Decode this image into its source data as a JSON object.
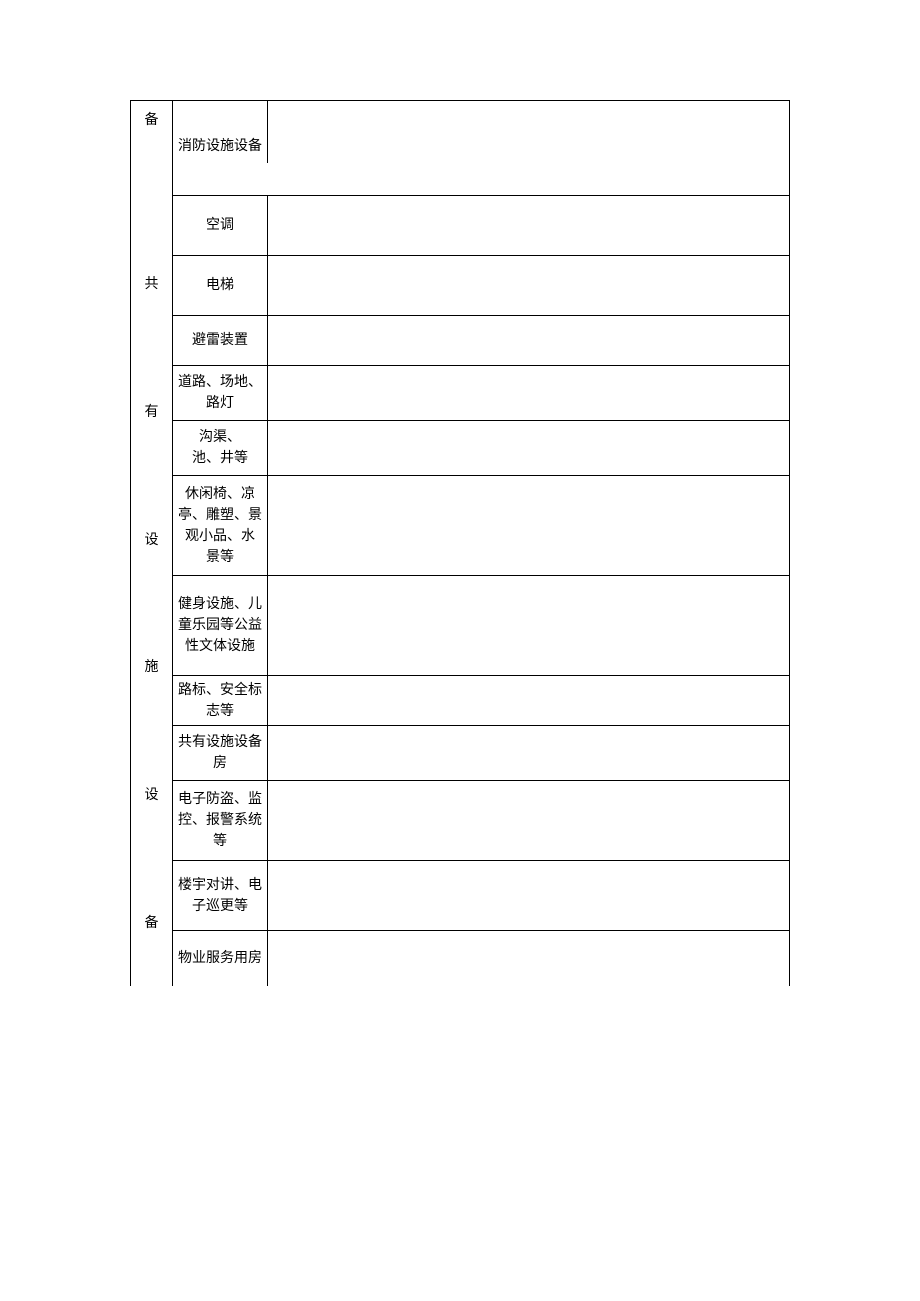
{
  "col1": {
    "top": "备",
    "spread": [
      "共",
      "有",
      "设",
      "施",
      "设",
      "备"
    ]
  },
  "rows": [
    {
      "label": "消防设施设备",
      "height": "row-top"
    },
    {
      "label": "空调",
      "height": "h60"
    },
    {
      "label": "电梯",
      "height": "h60"
    },
    {
      "label": "避雷装置",
      "height": "h50"
    },
    {
      "label": "道路、场地、路灯",
      "height": "h55"
    },
    {
      "label": "沟渠、\n池、井等",
      "height": "h55"
    },
    {
      "label": "休闲椅、凉亭、雕塑、景观小品、水\n景等",
      "height": "h100"
    },
    {
      "label": "健身设施、儿童乐园等公益性文体设施",
      "height": "h100"
    },
    {
      "label": "路标、安全标志等",
      "height": "h50"
    },
    {
      "label": "共有设施设备房",
      "height": "h55"
    },
    {
      "label": "电子防盗、监控、报警系统等",
      "height": "h80"
    },
    {
      "label": "楼宇对讲、电子巡更等",
      "height": "h70"
    },
    {
      "label": "物业服务用房",
      "height": "h55",
      "last": true
    }
  ]
}
